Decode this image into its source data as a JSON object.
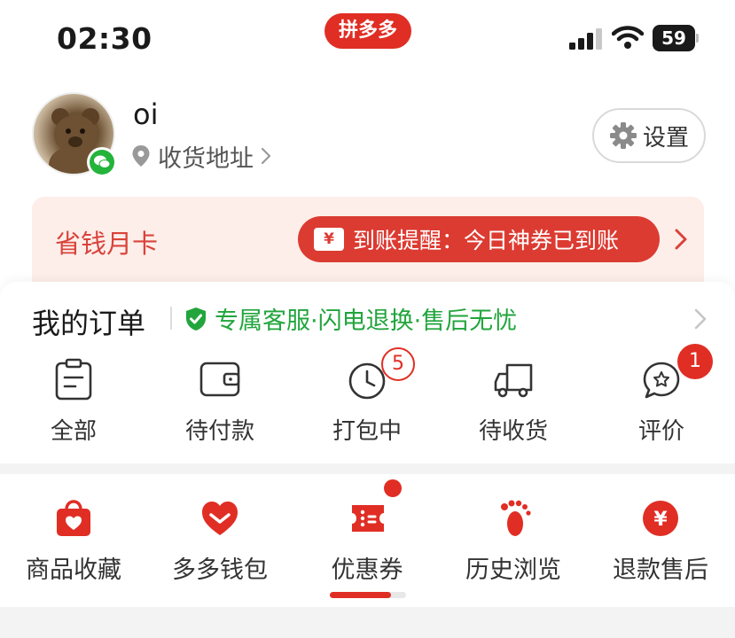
{
  "status_bar": {
    "time": "02:30",
    "app_name": "拼多多",
    "battery": "59"
  },
  "profile": {
    "username": "oi",
    "address_label": "收货地址",
    "settings_label": "设置"
  },
  "savings_card": {
    "title": "省钱月卡",
    "ticket_symbol": "¥",
    "notice": "到账提醒：今日神券已到账"
  },
  "orders": {
    "title": "我的订单",
    "perks": "专属客服·闪电退换·售后无忧",
    "items": [
      {
        "label": "全部",
        "icon": "clipboard-icon"
      },
      {
        "label": "待付款",
        "icon": "wallet-icon"
      },
      {
        "label": "打包中",
        "icon": "clock-icon",
        "badge": "5"
      },
      {
        "label": "待收货",
        "icon": "truck-icon"
      },
      {
        "label": "评价",
        "icon": "review-star-icon",
        "badge": "1"
      }
    ]
  },
  "tools": {
    "items": [
      {
        "label": "商品收藏",
        "icon": "favorite-bag-icon"
      },
      {
        "label": "多多钱包",
        "icon": "heart-wallet-icon"
      },
      {
        "label": "优惠券",
        "icon": "coupon-icon"
      },
      {
        "label": "历史浏览",
        "icon": "footprint-icon"
      },
      {
        "label": "退款售后",
        "icon": "refund-yen-icon",
        "symbol": "¥"
      }
    ],
    "scroll_progress": 0.8
  },
  "colors": {
    "brand_red": "#e02e24",
    "perk_green": "#21a53c",
    "card_bg": "#fdeeea"
  }
}
